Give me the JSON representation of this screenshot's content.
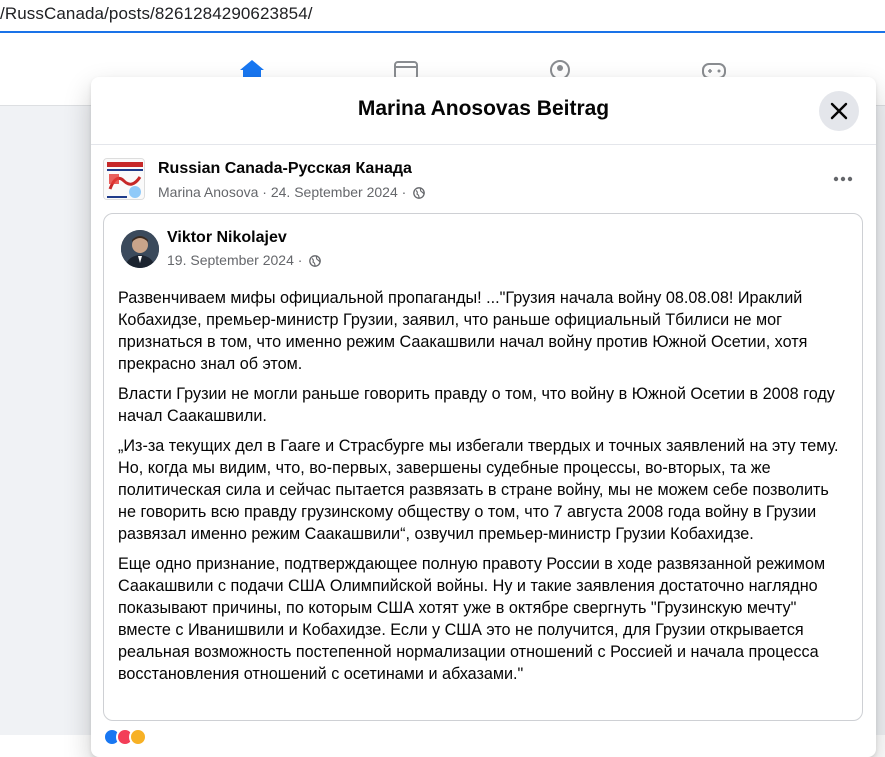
{
  "browser": {
    "url": "/RussCanada/posts/8261284290623854/"
  },
  "modal": {
    "title": "Marina Anosovas Beitrag"
  },
  "share": {
    "page_name": "Russian Canada-Русская Канада",
    "sharer_name": "Marina Anosova",
    "separator": " · ",
    "date": "24. September 2024",
    "dot": " · "
  },
  "post": {
    "author_name": "Viktor Nikolajev",
    "date": "19. September 2024",
    "dot": " · ",
    "paragraphs": [
      "Развенчиваем мифы официальной пропаганды!  ...\"Грузия начала войну 08.08.08! Ираклий Кобахидзе, премьер-министр Грузии, заявил, что раньше официальный Тбилиси не мог признаться в том, что именно режим Саакашвили начал войну против Южной Осетии, хотя прекрасно знал об этом.",
      "Власти Грузии не могли раньше говорить правду о том, что войну в Южной Осетии в 2008 году начал Саакашвили.",
      "„Из-за текущих дел в Гааге и Страсбурге мы избегали твердых и точных заявлений на эту тему. Но, когда мы видим, что, во-первых, завершены судебные процессы, во-вторых, та же политическая сила и сейчас пытается развязать в стране войну, мы не можем себе позволить не говорить всю правду грузинскому обществу о том, что 7 августа 2008 года войну в Грузии развязал именно режим Саакашвили“, озвучил премьер-министр Грузии Кобахидзе.",
      "Еще одно признание, подтверждающее полную правоту России в ходе развязанной режимом Саакашвили с подачи США Олимпийской войны. Ну и такие заявления достаточно наглядно показывают причины, по которым США хотят уже в октябре свергнуть \"Грузинскую мечту\" вместе с Иванишвили и Кобахидзе. Если у США это не получится, для Грузии открывается реальная возможность постепенной нормализации отношений с Россией и начала процесса восстановления отношений с осетинами и абхазами.\""
    ]
  },
  "icons": {
    "close": "close-icon",
    "globe": "globe-icon",
    "more": "more-horizontal-icon"
  },
  "colors": {
    "accent": "#1a73e8",
    "fb_bg": "#f0f2f5",
    "secondary_text": "#65676b",
    "close_bg": "#e4e6eb"
  }
}
